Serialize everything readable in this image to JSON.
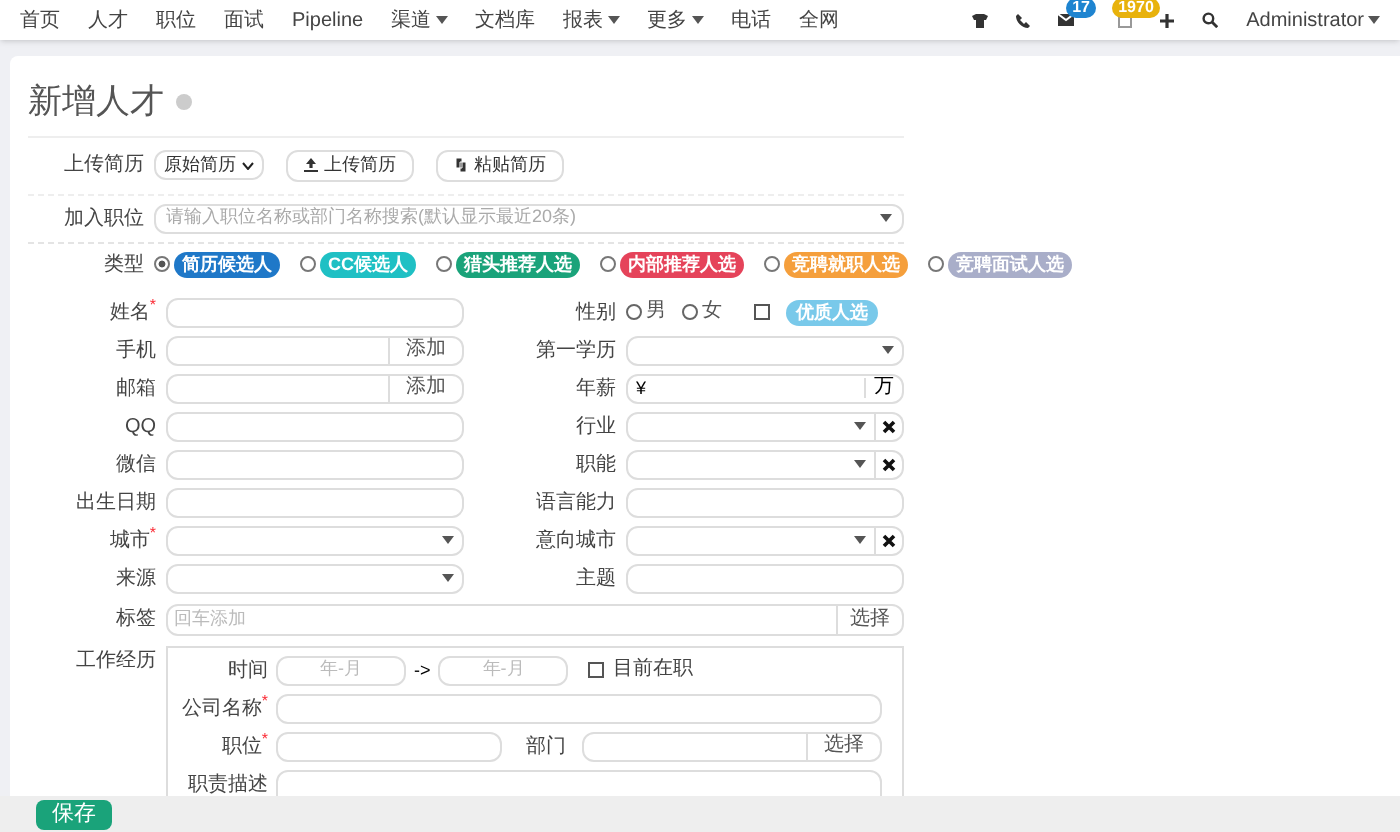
{
  "nav": {
    "items": [
      {
        "label": "首页",
        "dropdown": false
      },
      {
        "label": "人才",
        "dropdown": false
      },
      {
        "label": "职位",
        "dropdown": false
      },
      {
        "label": "面试",
        "dropdown": false
      },
      {
        "label": "Pipeline",
        "dropdown": false
      },
      {
        "label": "渠道",
        "dropdown": true
      },
      {
        "label": "文档库",
        "dropdown": false
      },
      {
        "label": "报表",
        "dropdown": true
      },
      {
        "label": "更多",
        "dropdown": true
      },
      {
        "label": "电话",
        "dropdown": false
      },
      {
        "label": "全网",
        "dropdown": false
      }
    ],
    "mail_badge": "17",
    "calendar_badge": "1970",
    "user": "Administrator"
  },
  "title": "新增人才",
  "upload": {
    "label": "上传简历",
    "select": "原始简历",
    "buttons": [
      "上传简历",
      "粘贴简历"
    ]
  },
  "position": {
    "label": "加入职位",
    "placeholder": "请输入职位名称或部门名称搜索(默认显示最近20条)"
  },
  "type": {
    "label": "类型",
    "options": [
      {
        "label": "简历候选人",
        "color": "#1f78c8",
        "selected": true
      },
      {
        "label": "CC候选人",
        "color": "#1fc0c4",
        "selected": false
      },
      {
        "label": "猎头推荐人选",
        "color": "#1aa37a",
        "selected": false
      },
      {
        "label": "内部推荐人选",
        "color": "#e5435a",
        "selected": false
      },
      {
        "label": "竞聘就职人选",
        "color": "#f59f3c",
        "selected": false
      },
      {
        "label": "竞聘面试人选",
        "color": "#a9aec9",
        "selected": false
      }
    ]
  },
  "rows": [
    {
      "left": {
        "label": "姓名",
        "required_mark": "*",
        "kind": "text"
      },
      "right": {
        "label": "性别",
        "kind": "gender",
        "options": [
          {
            "label": "男",
            "selected": false
          },
          {
            "label": "女",
            "selected": false
          }
        ],
        "check": {
          "label": "优质人选",
          "checked": false
        }
      }
    },
    {
      "left": {
        "label": "手机",
        "kind": "addon",
        "addon": "添加"
      },
      "right": {
        "label": "第一学历",
        "kind": "select"
      }
    },
    {
      "left": {
        "label": "邮箱",
        "kind": "addon",
        "addon": "添加"
      },
      "right": {
        "label": "年薪",
        "kind": "money",
        "prefix": "¥",
        "suffix": "万"
      }
    },
    {
      "left": {
        "label": "QQ",
        "kind": "text"
      },
      "right": {
        "label": "行业",
        "kind": "clear"
      }
    },
    {
      "left": {
        "label": "微信",
        "kind": "text"
      },
      "right": {
        "label": "职能",
        "kind": "clear"
      }
    },
    {
      "left": {
        "label": "出生日期",
        "kind": "text"
      },
      "right": {
        "label": "语言能力",
        "kind": "text"
      }
    },
    {
      "left": {
        "label": "城市",
        "required_mark": "*",
        "kind": "select"
      },
      "right": {
        "label": "意向城市",
        "kind": "clear"
      }
    },
    {
      "left": {
        "label": "来源",
        "kind": "select"
      },
      "right": {
        "label": "主题",
        "kind": "text"
      }
    }
  ],
  "tags": {
    "label": "标签",
    "placeholder": "回车添加",
    "button": "选择"
  },
  "work": {
    "label": "工作经历",
    "time_label": "时间",
    "from_placeholder": "年-月",
    "arrow": "->",
    "to_placeholder": "年-月",
    "current": {
      "label": "目前在职",
      "checked": false
    },
    "company_label": "公司名称",
    "company_mark": "*",
    "title_label": "职位",
    "title_mark": "*",
    "dept_label": "部门",
    "dept_button": "选择",
    "duty_label": "职责描述"
  },
  "save": "保存"
}
